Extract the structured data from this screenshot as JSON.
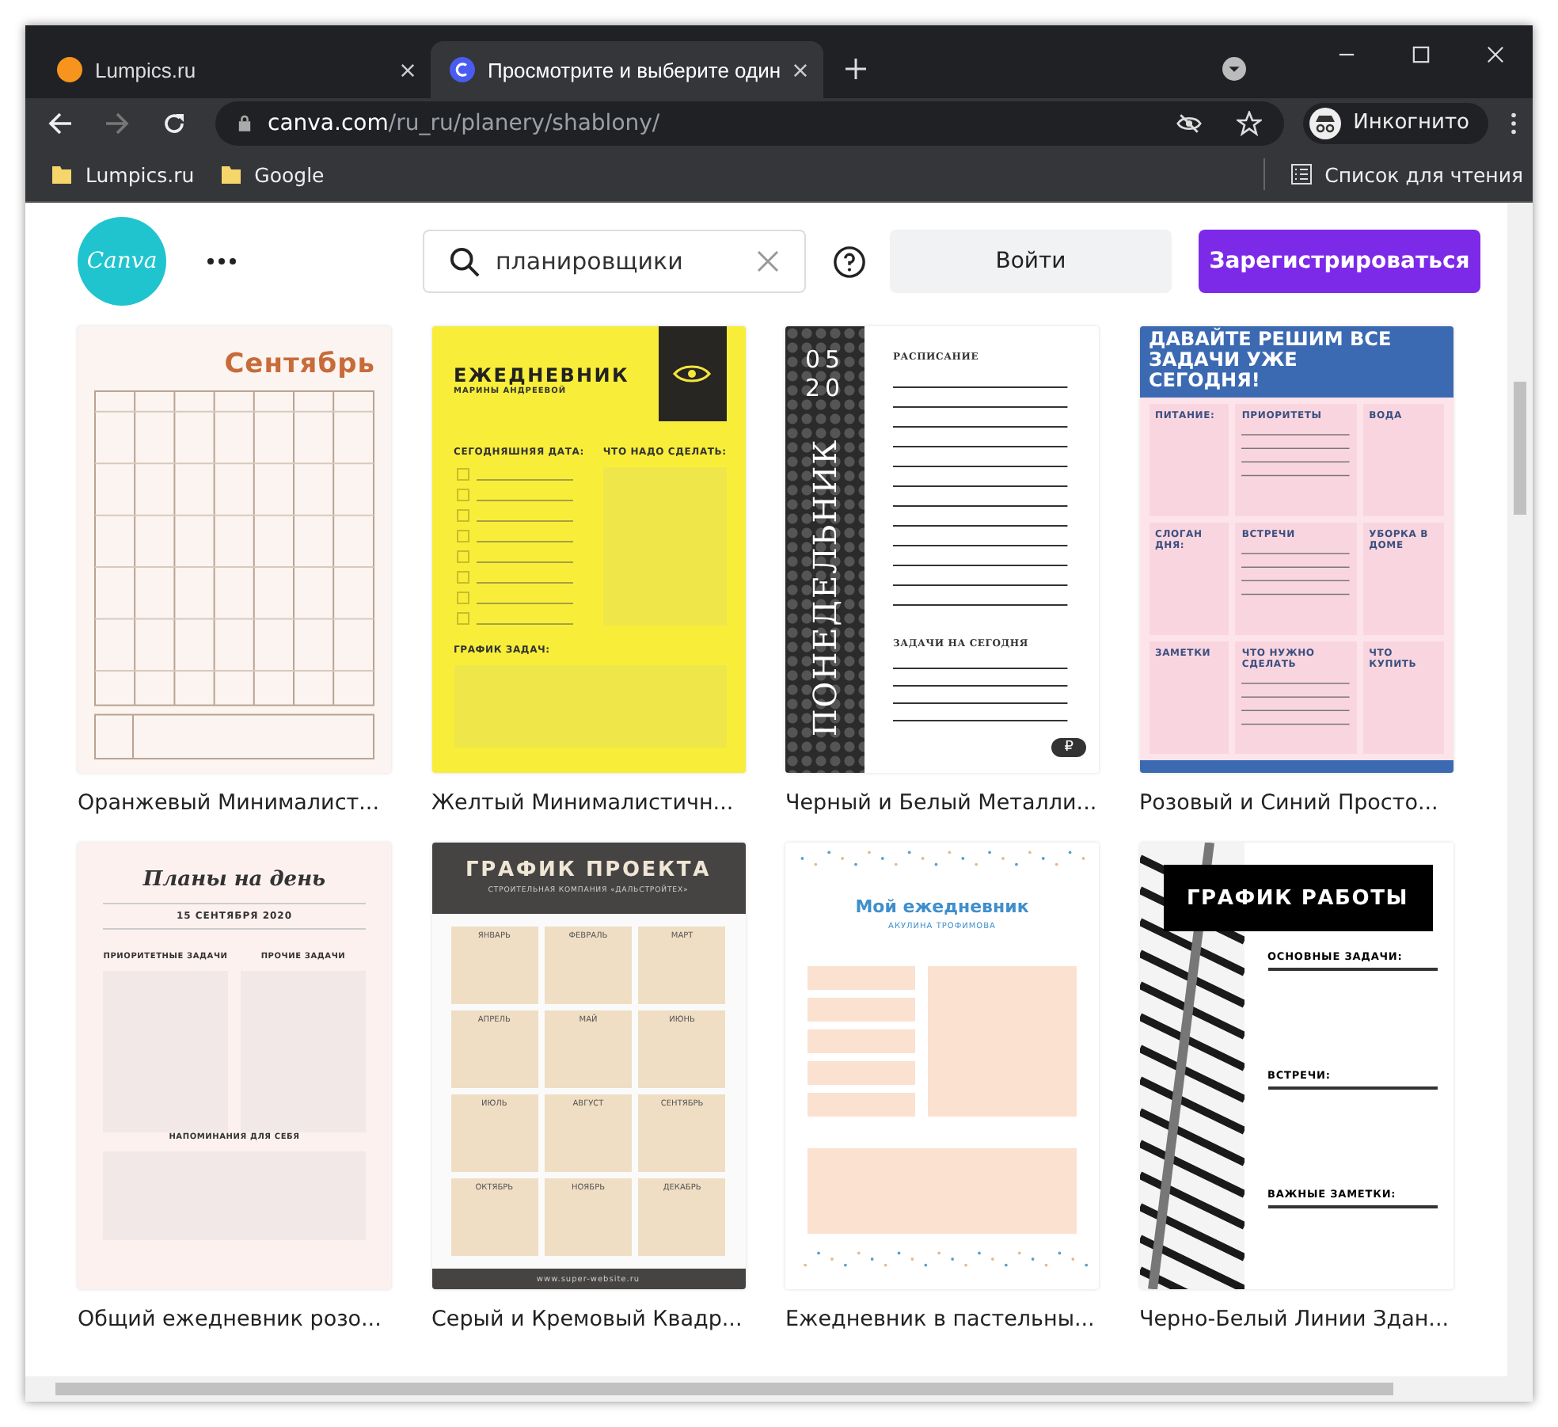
{
  "browser": {
    "tabs": [
      {
        "title": "Lumpics.ru",
        "selected": false,
        "kind": "dot"
      },
      {
        "title": "Просмотрите и выберите один",
        "selected": true,
        "kind": "logo"
      }
    ],
    "url_host": "canva.com",
    "url_path": "/ru_ru/planery/shablony/",
    "profile": "Инкогнито",
    "bookmarks": [
      "Lumpics.ru",
      "Google"
    ],
    "reading_list": "Список для чтения"
  },
  "header": {
    "logo": "Canva",
    "search": {
      "value": "планировщики"
    },
    "login": "Войти",
    "signup": "Зарегистрироваться"
  },
  "templates": [
    {
      "kind": "calendar",
      "title": "Сентябрь",
      "caption": "Оранжевый Минималист..."
    },
    {
      "kind": "yellow",
      "title": "ЕЖЕДНЕВНИК",
      "subtitle": "МАРИНЫ АНДРЕЕВОЙ",
      "labels": [
        "СЕГОДНЯШНЯЯ ДАТА:",
        "ЧТО НАДО СДЕЛАТЬ:",
        "ГРАФИК ЗАДАЧ:"
      ],
      "caption": "Желтый Минималистичн..."
    },
    {
      "kind": "dark",
      "title": "ПОНЕДЕЛЬНИК",
      "numbers": [
        "05",
        "20"
      ],
      "labels": [
        "РАСПИСАНИЕ",
        "ЗАДАЧИ НА СЕГОДНЯ"
      ],
      "badge": "₽",
      "caption": "Черный и Белый Металли..."
    },
    {
      "kind": "pink",
      "title": "ДАВАЙТЕ РЕШИМ ВСЕ ЗАДАЧИ УЖЕ СЕГОДНЯ!",
      "columns": [
        [
          "ПИТАНИЕ:",
          "СЛОГАН ДНЯ:",
          "ЗАМЕТКИ"
        ],
        [
          "ПРИОРИТЕТЫ",
          "ВСТРЕЧИ",
          "ЧТО НУЖНО СДЕЛАТЬ"
        ],
        [
          "ВОДА",
          "УБОРКА В ДОМЕ",
          "ЧТО КУПИТЬ"
        ]
      ],
      "caption": "Розовый и Синий Просто..."
    },
    {
      "kind": "daily",
      "title": "Планы на день",
      "subtitle": "15 СЕНТЯБРЯ 2020",
      "labels": [
        "ПРИОРИТЕТНЫЕ ЗАДАЧИ",
        "ПРОЧИЕ ЗАДАЧИ",
        "НАПОМИНАНИЯ ДЛЯ СЕБЯ"
      ],
      "caption": "Общий ежедневник розо..."
    },
    {
      "kind": "project",
      "title": "ГРАФИК ПРОЕКТА",
      "subtitle": "СТРОИТЕЛЬНАЯ КОМПАНИЯ «ДАЛЬСТРОЙТЕХ»",
      "labels": [
        "ЯНВАРЬ",
        "ФЕВРАЛЬ",
        "МАРТ",
        "АПРЕЛЬ",
        "МАЙ",
        "ИЮНЬ",
        "ИЮЛЬ",
        "АВГУСТ",
        "СЕНТЯБРЬ",
        "ОКТЯБРЬ",
        "НОЯБРЬ",
        "ДЕКАБРЬ"
      ],
      "footer": "www.super-website.ru",
      "caption": "Серый и Кремовый Квадр..."
    },
    {
      "kind": "pastel",
      "title": "Мой ежедневник",
      "subtitle": "АКУЛИНА ТРОФИМОВА",
      "caption": "Ежедневник в пастельны..."
    },
    {
      "kind": "stripes",
      "title": "ГРАФИК РАБОТЫ",
      "labels": [
        "ОСНОВНЫЕ ЗАДАЧИ:",
        "ВСТРЕЧИ:",
        "ВАЖНЫЕ ЗАМЕТКИ:"
      ],
      "caption": "Черно-Белый Линии Здан..."
    }
  ]
}
